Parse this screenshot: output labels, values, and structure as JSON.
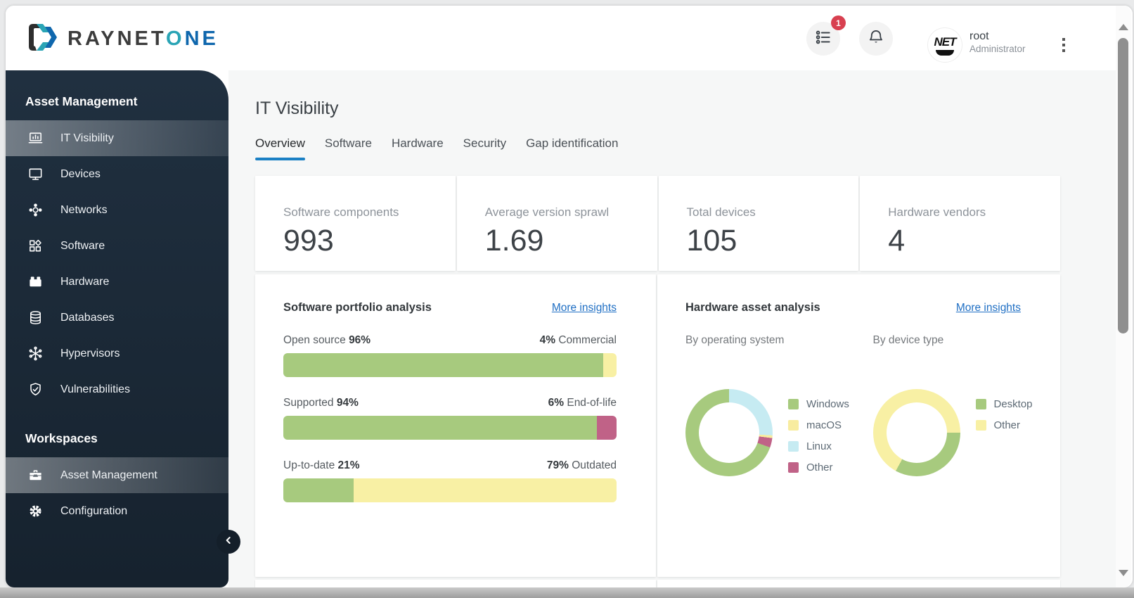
{
  "theme": {
    "accent": "#1b80c4",
    "link_blue": "#1f6fc4",
    "sidebar_bg": "#1c2a39",
    "badge_red": "#d84050",
    "green": "#a7ca7e",
    "yellow": "#f8f0a4",
    "pink": "#c06287",
    "cyan": "#c6ebf2",
    "logo_teal": "#2aa4b5",
    "logo_blue": "#0f67ad"
  },
  "header": {
    "logo": {
      "primary": "RAYNET",
      "accent_o": "O",
      "accent_ne": "NE"
    },
    "tasks_badge": "1",
    "user": {
      "name": "root",
      "role": "Administrator",
      "avatar_text": "NET"
    }
  },
  "sidebar": {
    "sections": [
      {
        "title": "Asset Management",
        "items": [
          {
            "label": "IT Visibility",
            "icon": "laptop-chart-icon",
            "active": true
          },
          {
            "label": "Devices",
            "icon": "monitor-icon"
          },
          {
            "label": "Networks",
            "icon": "network-icon"
          },
          {
            "label": "Software",
            "icon": "software-grid-icon"
          },
          {
            "label": "Hardware",
            "icon": "hardware-icon"
          },
          {
            "label": "Databases",
            "icon": "database-icon"
          },
          {
            "label": "Hypervisors",
            "icon": "hypervisor-icon"
          },
          {
            "label": "Vulnerabilities",
            "icon": "shield-check-icon"
          }
        ]
      },
      {
        "title": "Workspaces",
        "items": [
          {
            "label": "Asset Management",
            "icon": "briefcase-icon",
            "active": true
          },
          {
            "label": "Configuration",
            "icon": "gear-icon"
          }
        ]
      }
    ]
  },
  "page": {
    "title": "IT Visibility",
    "tabs": [
      {
        "label": "Overview",
        "active": true
      },
      {
        "label": "Software"
      },
      {
        "label": "Hardware"
      },
      {
        "label": "Security"
      },
      {
        "label": "Gap identification"
      }
    ]
  },
  "stats": [
    {
      "label": "Software components",
      "value": "993"
    },
    {
      "label": "Average version sprawl",
      "value": "1.69"
    },
    {
      "label": "Total devices",
      "value": "105"
    },
    {
      "label": "Hardware vendors",
      "value": "4"
    }
  ],
  "software_portfolio": {
    "title": "Software portfolio analysis",
    "link": "More insights",
    "bars": [
      {
        "left_label": "Open source",
        "left_pct": "96%",
        "left_value": 96,
        "right_pct": "4%",
        "right_label": "Commercial",
        "left_color": "#a7ca7e",
        "right_color": "#f8f0a4"
      },
      {
        "left_label": "Supported",
        "left_pct": "94%",
        "left_value": 94,
        "right_pct": "6%",
        "right_label": "End-of-life",
        "left_color": "#a7ca7e",
        "right_color": "#c06287"
      },
      {
        "left_label": "Up-to-date",
        "left_pct": "21%",
        "left_value": 21,
        "right_pct": "79%",
        "right_label": "Outdated",
        "left_color": "#a7ca7e",
        "right_color": "#f8f0a4"
      }
    ]
  },
  "hardware_assets": {
    "title": "Hardware asset analysis",
    "link": "More insights",
    "charts": [
      {
        "subtitle": "By operating system",
        "arcs": [
          {
            "name": "Linux",
            "color": "#c6ebf2",
            "from": 0,
            "to": 26
          },
          {
            "name": "macOS",
            "color": "#f8ec9f",
            "from": 26,
            "to": 27
          },
          {
            "name": "Other",
            "color": "#c06287",
            "from": 27,
            "to": 30.5
          },
          {
            "name": "Windows",
            "color": "#a7ca7e",
            "from": 30.5,
            "to": 100
          }
        ],
        "legend": [
          {
            "label": "Windows",
            "color": "#a7ca7e"
          },
          {
            "label": "macOS",
            "color": "#f8ec9f"
          },
          {
            "label": "Linux",
            "color": "#c6ebf2"
          },
          {
            "label": "Other",
            "color": "#c06287"
          }
        ]
      },
      {
        "subtitle": "By device type",
        "arcs": [
          {
            "name": "Other",
            "color": "#f8f0a4",
            "from": 0,
            "to": 25
          },
          {
            "name": "Desktop",
            "color": "#a7ca7e",
            "from": 25,
            "to": 58
          },
          {
            "name": "Other",
            "color": "#f8f0a4",
            "from": 58,
            "to": 100
          }
        ],
        "legend": [
          {
            "label": "Desktop",
            "color": "#a7ca7e"
          },
          {
            "label": "Other",
            "color": "#f8f0a4"
          }
        ]
      }
    ]
  },
  "chart_data": [
    {
      "type": "bar",
      "title": "Software portfolio analysis",
      "stacked": true,
      "unit": "%",
      "categories": [
        "Open source vs Commercial",
        "Supported vs End-of-life",
        "Up-to-date vs Outdated"
      ],
      "series": [
        {
          "name": "Open source / Supported / Up-to-date",
          "values": [
            96,
            94,
            21
          ]
        },
        {
          "name": "Commercial / End-of-life / Outdated",
          "values": [
            4,
            6,
            79
          ]
        }
      ]
    },
    {
      "type": "pie",
      "title": "Hardware asset analysis — By operating system",
      "unit": "%",
      "labels": [
        "Windows",
        "macOS",
        "Linux",
        "Other"
      ],
      "values": [
        69.5,
        1,
        26,
        3.5
      ],
      "legend_position": "right"
    },
    {
      "type": "pie",
      "title": "Hardware asset analysis — By device type",
      "unit": "%",
      "labels": [
        "Desktop",
        "Other"
      ],
      "values": [
        33,
        67
      ],
      "legend_position": "right"
    }
  ]
}
